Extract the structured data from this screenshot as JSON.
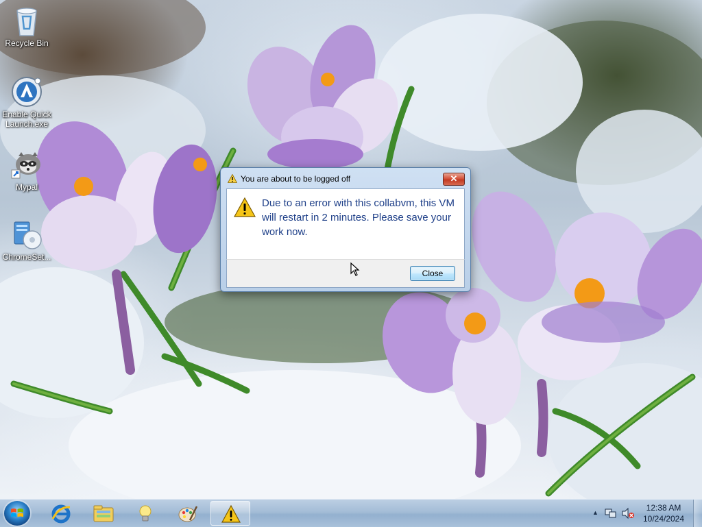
{
  "desktop": {
    "icons": [
      {
        "label": "Recycle Bin",
        "icon": "recycle-bin-icon"
      },
      {
        "label": "Enable Quick Launch.exe",
        "icon": "quick-launch-icon"
      },
      {
        "label": "Mypal",
        "icon": "mypal-raccoon-icon"
      },
      {
        "label": "ChromeSet...",
        "icon": "chrome-setup-icon"
      }
    ]
  },
  "dialog": {
    "title": "You are about to be logged off",
    "message": "Due to an error with this collabvm, this VM will restart in 2 minutes. Please save your work now.",
    "close_button": "Close",
    "close_glyph": "✕"
  },
  "taskbar": {
    "items": [
      {
        "icon": "internet-explorer-icon"
      },
      {
        "icon": "file-explorer-icon"
      },
      {
        "icon": "lightbulb-icon"
      },
      {
        "icon": "paint-palette-icon"
      },
      {
        "icon": "warning-icon",
        "active": true
      }
    ],
    "tray": {
      "chevron": "▲",
      "time": "12:38 AM",
      "date": "10/24/2024"
    }
  },
  "colors": {
    "dialog_message": "#1e3f88",
    "taskbar": "#a4bdd7",
    "crocus_purple": "#9b6cc8",
    "crocus_stamen": "#f39a16"
  }
}
